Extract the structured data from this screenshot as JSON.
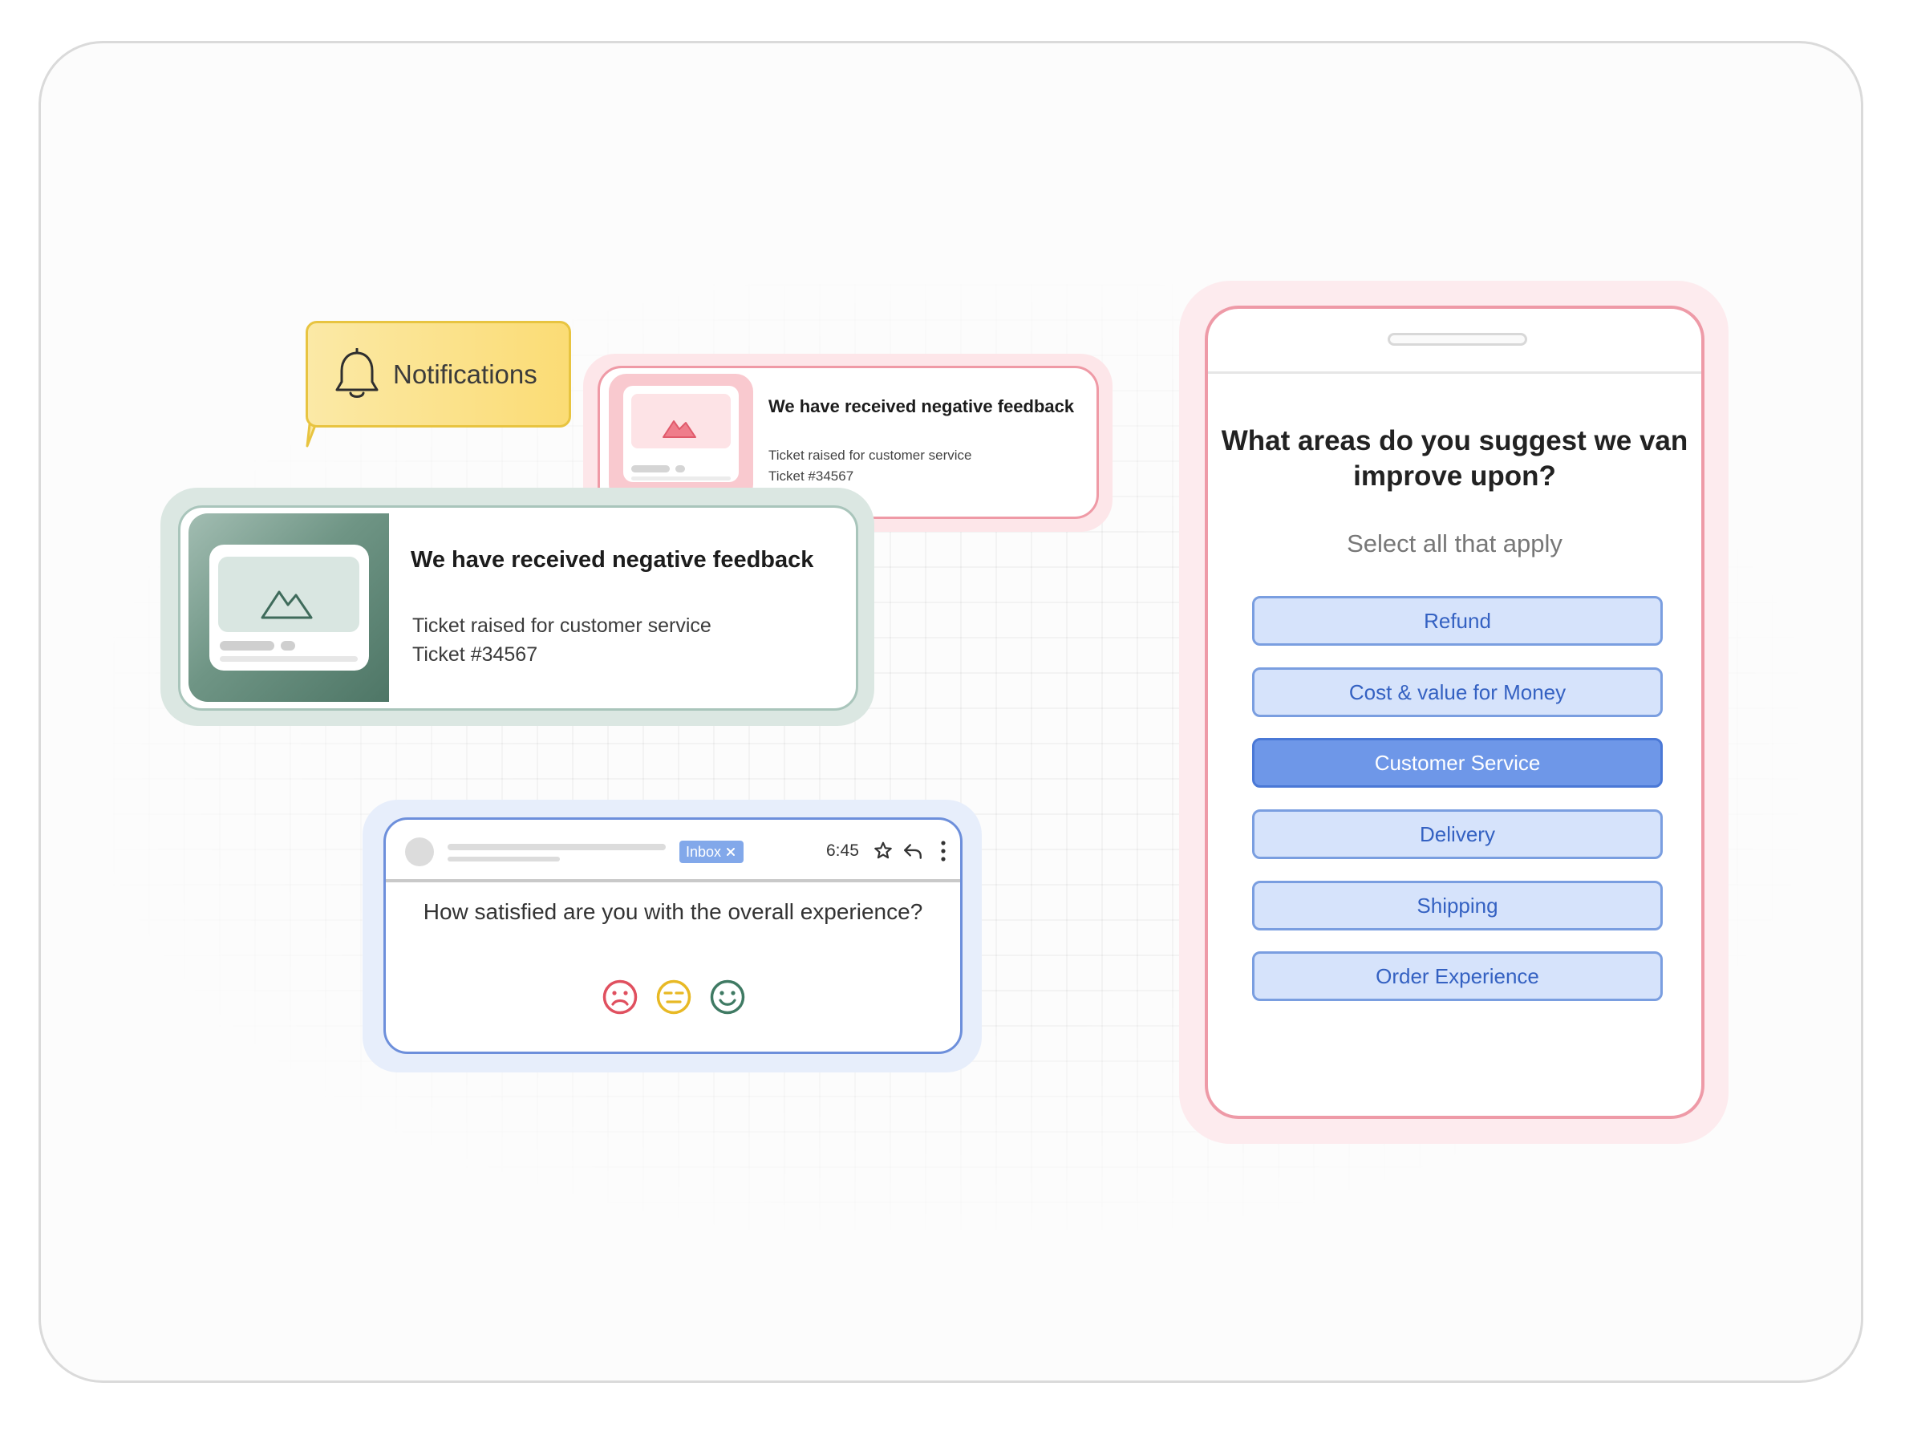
{
  "notifications_bubble": {
    "label": "Notifications"
  },
  "notification_small": {
    "title": "We have received negative feedback",
    "subtitle": "Ticket raised for customer service",
    "ticket": "Ticket #34567"
  },
  "notification_large": {
    "title": "We have received negative feedback",
    "subtitle": "Ticket raised for customer service",
    "ticket": "Ticket #34567"
  },
  "email": {
    "tag": "Inbox",
    "time": "6:45",
    "question": "How satisfied are you with the overall experience?",
    "ratings": [
      "sad-face-icon",
      "neutral-face-icon",
      "happy-face-icon"
    ]
  },
  "survey": {
    "title": "What areas do you suggest we van improve upon?",
    "subtitle": "Select all that apply",
    "options": [
      {
        "label": "Refund",
        "selected": false
      },
      {
        "label": "Cost & value for Money",
        "selected": false
      },
      {
        "label": "Customer Service",
        "selected": true
      },
      {
        "label": "Delivery",
        "selected": false
      },
      {
        "label": "Shipping",
        "selected": false
      },
      {
        "label": "Order Experience",
        "selected": false
      }
    ]
  },
  "colors": {
    "accent_blue": "#6e97e8",
    "option_fill": "#d6e3fb",
    "alert_pink": "#ee9aa7",
    "alert_green": "#6f9585",
    "bubble_yellow": "#fbdc75",
    "rating_sad": "#e0505f",
    "rating_neutral": "#e8b925",
    "rating_happy": "#3f7a63"
  }
}
